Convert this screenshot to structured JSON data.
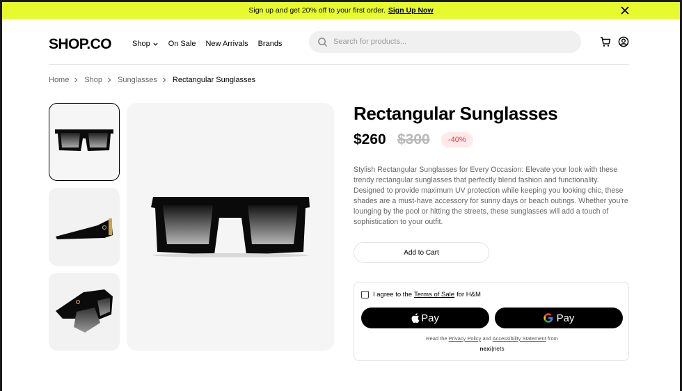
{
  "promo": {
    "text": "Sign up and get 20% off to your first order.",
    "link": "Sign Up Now"
  },
  "header": {
    "logo": "SHOP.CO",
    "menu": [
      "Shop",
      "On Sale",
      "New Arrivals",
      "Brands"
    ],
    "search_placeholder": "Search for products..."
  },
  "breadcrumb": [
    "Home",
    "Shop",
    "Sunglasses",
    "Rectangular Sunglasses"
  ],
  "product": {
    "title": "Rectangular Sunglasses",
    "price": "$260",
    "old_price": "$300",
    "discount": "-40%",
    "description": "Stylish Rectangular Sunglasses for Every Occasion: Elevate your look with these trendy rectangular sunglasses that perfectly blend fashion and functionality. Designed to provide maximum UV protection while keeping you looking chic, these shades are a must-have accessory for sunny days or beach outings. Whether you're lounging by the pool or hitting the streets, these sunglasses will add a touch of sophistication to your outfit.",
    "add_to_cart": "Add to Cart"
  },
  "payment": {
    "agree_prefix": "I agree to the",
    "terms_link": "Terms of Sale",
    "agree_suffix": "for H&M",
    "apple_pay": "Pay",
    "google_pay": "Pay",
    "legal_prefix": "Read the",
    "privacy_link": "Privacy Policy",
    "legal_and": "and",
    "accessibility_link": "Accessibility Statement",
    "legal_suffix": "from",
    "brand_left": "nexi",
    "brand_right": "nets"
  },
  "colors": {
    "promo_bg": "#e6fa2d",
    "discount_bg": "#ffe9e9",
    "discount_text": "#ff3333"
  },
  "icons": [
    "close-icon",
    "chevron-down-icon",
    "search-icon",
    "cart-icon",
    "account-icon",
    "chevron-right-icon",
    "apple-icon",
    "google-icon"
  ]
}
